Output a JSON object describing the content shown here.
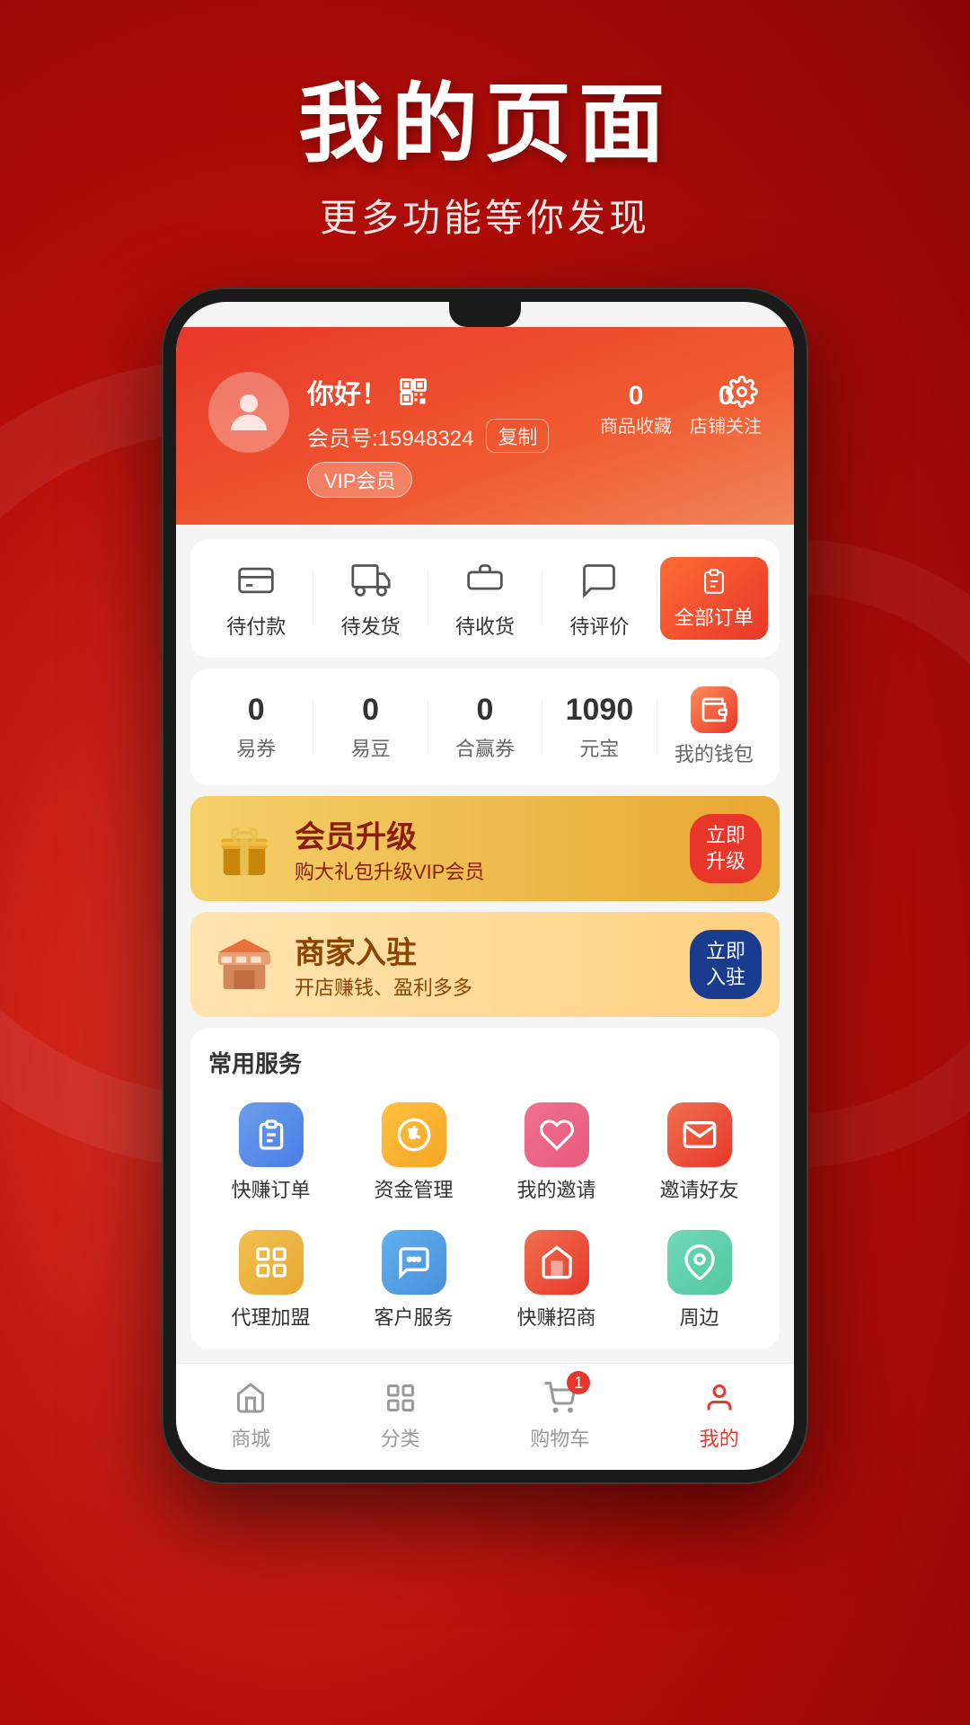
{
  "background": {
    "color1": "#e8372a",
    "color2": "#b50d08"
  },
  "page_title": {
    "main": "我的页面",
    "sub": "更多功能等你发现"
  },
  "profile": {
    "greeting": "你好！",
    "member_id_label": "会员号:",
    "member_id": "15948324",
    "copy_label": "复制",
    "vip_label": "VIP会员",
    "stats": [
      {
        "num": "0",
        "label": "商品收藏"
      },
      {
        "num": "0",
        "label": "店铺关注"
      }
    ]
  },
  "orders": {
    "items": [
      {
        "label": "待付款"
      },
      {
        "label": "待发货"
      },
      {
        "label": "待收货"
      },
      {
        "label": "待评价"
      }
    ],
    "all_orders_label": "全部订单"
  },
  "wallet": {
    "items": [
      {
        "num": "0",
        "label": "易券"
      },
      {
        "num": "0",
        "label": "易豆"
      },
      {
        "num": "0",
        "label": "合赢券"
      },
      {
        "num": "1090",
        "label": "元宝"
      }
    ],
    "wallet_label": "我的钱包"
  },
  "banners": {
    "vip": {
      "title": "会员升级",
      "desc": "购大礼包升级VIP会员",
      "btn": "立即\n升级"
    },
    "merchant": {
      "title": "商家入驻",
      "desc": "开店赚钱、盈利多多",
      "btn": "立即\n入驻"
    }
  },
  "services": {
    "section_title": "常用服务",
    "items": [
      {
        "label": "快赚订单",
        "color": "#4a7de8"
      },
      {
        "label": "资金管理",
        "color": "#f5a623"
      },
      {
        "label": "我的邀请",
        "color": "#e85a7a"
      },
      {
        "label": "邀请好友",
        "color": "#e8372a"
      },
      {
        "label": "代理加盟",
        "color": "#e8a832"
      },
      {
        "label": "客户服务",
        "color": "#4a90d9"
      },
      {
        "label": "快赚招商",
        "color": "#e8372a"
      },
      {
        "label": "周边",
        "color": "#52c8a0"
      }
    ]
  },
  "bottom_nav": {
    "items": [
      {
        "label": "商城",
        "active": false
      },
      {
        "label": "分类",
        "active": false
      },
      {
        "label": "购物车",
        "active": false,
        "badge": "1"
      },
      {
        "label": "我的",
        "active": true
      }
    ]
  }
}
